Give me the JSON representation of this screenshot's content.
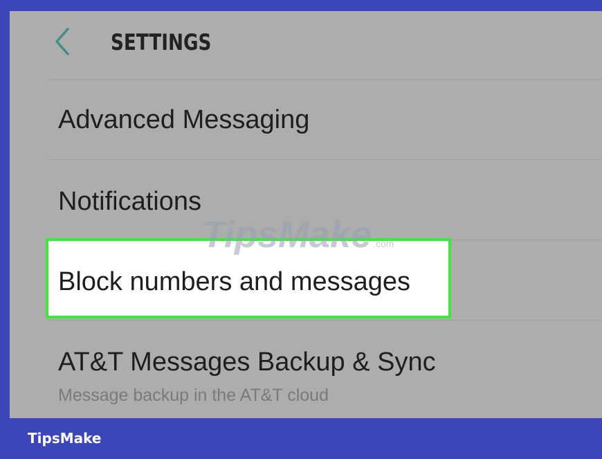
{
  "header": {
    "title": "SETTINGS",
    "back_icon": "chevron-left-icon",
    "back_icon_color": "#3f8f86"
  },
  "menu": {
    "items": [
      {
        "label": "Advanced Messaging"
      },
      {
        "label": "Notifications"
      },
      {
        "label": "Block numbers and messages",
        "highlighted": true
      },
      {
        "label": "AT&T Messages Backup & Sync",
        "subtitle": "Message backup in the AT&T cloud"
      }
    ]
  },
  "watermark": {
    "text": "TipsMake",
    "suffix": ".com"
  },
  "footer": {
    "brand": "TipsMake"
  },
  "colors": {
    "frame": "#3d46b8",
    "screen": "#adadad",
    "highlight_border": "#3de83d",
    "highlight_fill": "#ffffff"
  }
}
